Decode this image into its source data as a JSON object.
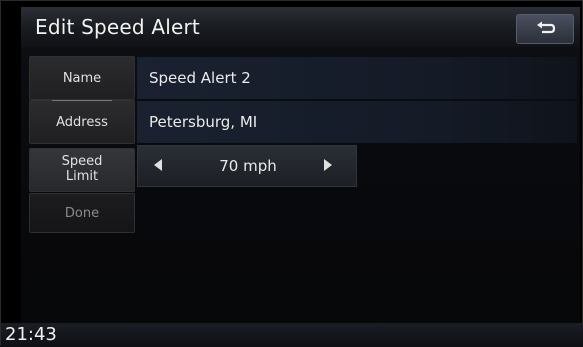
{
  "header": {
    "title": "Edit Speed Alert"
  },
  "sidebar": {
    "name_label": "Name",
    "address_label": "Address",
    "speed_limit_label_line1": "Speed",
    "speed_limit_label_line2": "Limit",
    "done_label": "Done"
  },
  "fields": {
    "name_value": "Speed Alert 2",
    "address_value": "Petersburg, MI",
    "speed_value": "70 mph"
  },
  "status": {
    "clock": "21:43"
  },
  "icons": {
    "back": "return-arrow-icon",
    "decrease": "left-arrow-icon",
    "increase": "right-arrow-icon"
  }
}
